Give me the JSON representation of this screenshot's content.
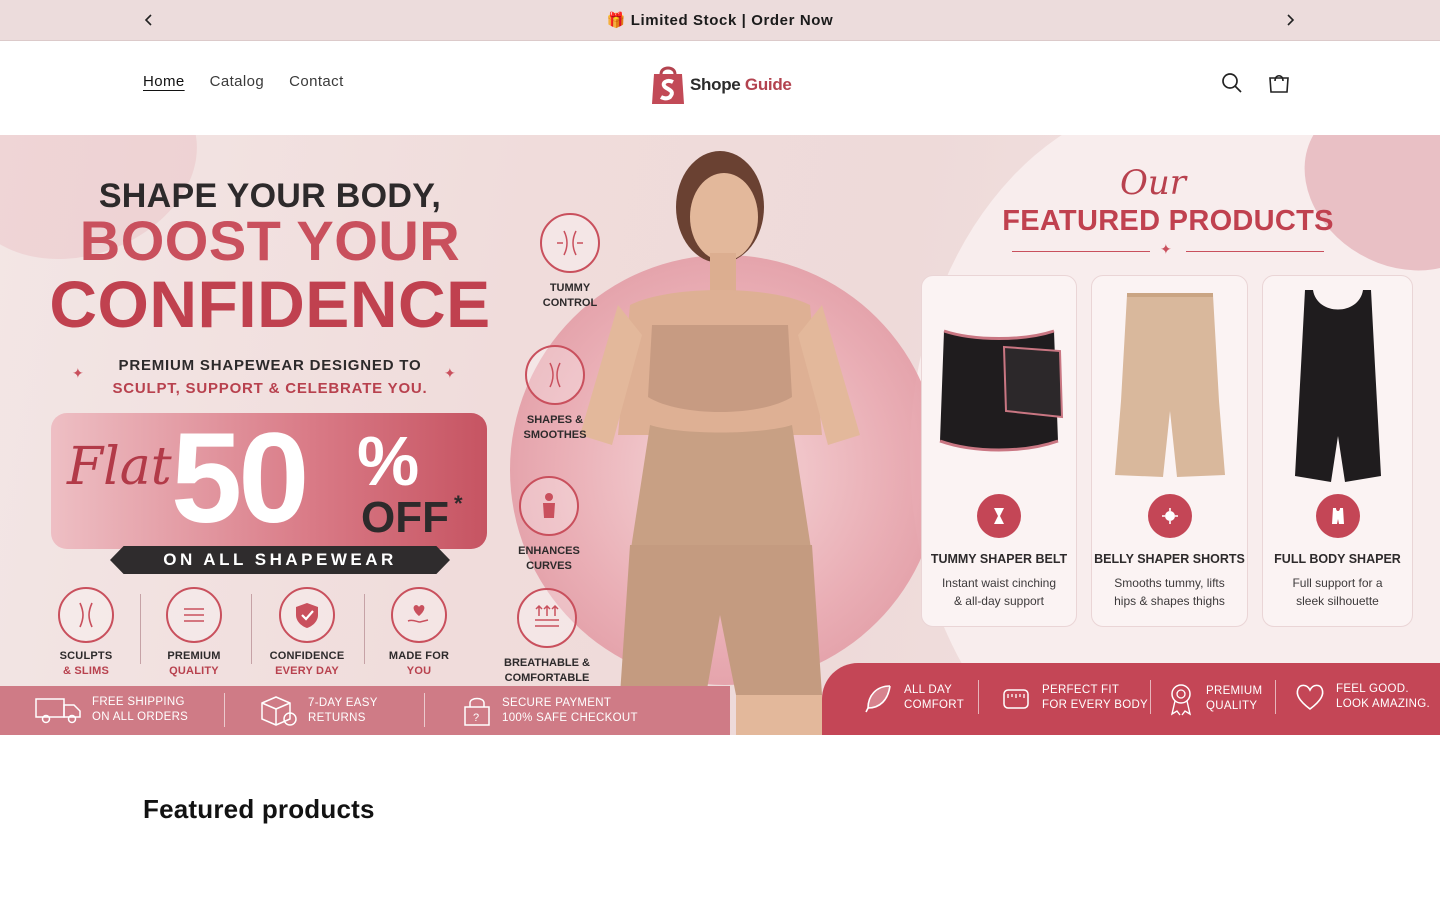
{
  "announcement": {
    "text": "🎁 Limited Stock | Order Now"
  },
  "nav": {
    "items": [
      "Home",
      "Catalog",
      "Contact"
    ],
    "active": "Home"
  },
  "logo": {
    "word1": "Shope",
    "word2": "Guide"
  },
  "hero": {
    "headline1": "SHAPE YOUR BODY,",
    "headline2": "BOOST YOUR",
    "headline3": "CONFIDENCE",
    "sub1": "PREMIUM SHAPEWEAR DESIGNED TO",
    "sub2": "SCULPT, SUPPORT & CELEBRATE YOU.",
    "offer_flat": "Flat",
    "offer_value": "50",
    "offer_pct": "%",
    "offer_off": "OFF",
    "offer_star": "*",
    "ribbon": "ON ALL SHAPEWEAR",
    "bottom_features": [
      {
        "a": "SCULPTS",
        "b": "& SLIMS"
      },
      {
        "a": "PREMIUM",
        "b": "QUALITY"
      },
      {
        "a": "CONFIDENCE",
        "b": "EVERY DAY"
      },
      {
        "a": "MADE FOR",
        "b": "YOU"
      }
    ],
    "side_features": [
      {
        "a": "TUMMY",
        "b": "CONTROL"
      },
      {
        "a": "SHAPES &",
        "b": "SMOOTHES"
      },
      {
        "a": "ENHANCES",
        "b": "CURVES"
      },
      {
        "a": "BREATHABLE &",
        "b": "COMFORTABLE"
      }
    ],
    "featured_script": "Our",
    "featured_title": "FEATURED PRODUCTS",
    "cards": [
      {
        "name": "TUMMY SHAPER BELT",
        "desc1": "Instant waist cinching",
        "desc2": "& all-day support"
      },
      {
        "name": "BELLY SHAPER SHORTS",
        "desc1": "Smooths tummy, lifts",
        "desc2": "hips & shapes thighs"
      },
      {
        "name": "FULL BODY SHAPER",
        "desc1": "Full support for a",
        "desc2": "sleek silhouette"
      }
    ],
    "band_left": [
      {
        "a": "FREE SHIPPING",
        "b": "ON ALL ORDERS"
      },
      {
        "a": "7-DAY EASY",
        "b": "RETURNS"
      },
      {
        "a": "SECURE PAYMENT",
        "b": "100% SAFE CHECKOUT"
      }
    ],
    "band_right": [
      {
        "a": "ALL DAY",
        "b": "COMFORT"
      },
      {
        "a": "PERFECT FIT",
        "b": "FOR EVERY BODY"
      },
      {
        "a": "PREMIUM",
        "b": "QUALITY"
      },
      {
        "a": "FEEL GOOD.",
        "b": "LOOK AMAZING."
      }
    ]
  },
  "section": {
    "title": "Featured products"
  },
  "colors": {
    "accent": "#c0414f",
    "announcement_bg": "#ecdcdc",
    "band_right": "#c44656"
  }
}
